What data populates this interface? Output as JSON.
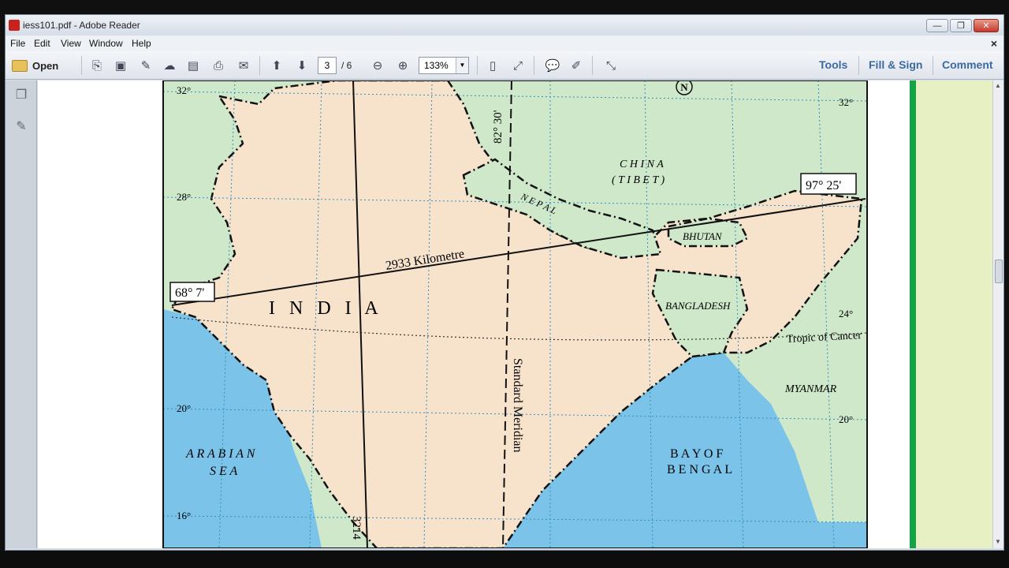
{
  "window": {
    "title": "iess101.pdf - Adobe Reader",
    "min": "—",
    "max": "❐",
    "close": "✕"
  },
  "menu": {
    "file": "File",
    "edit": "Edit",
    "view": "View",
    "window": "Window",
    "help": "Help",
    "close_doc": "×"
  },
  "toolbar": {
    "open_label": "Open",
    "page_current": "3",
    "page_total": "/ 6",
    "zoom": "133%",
    "tools_label": "Tools",
    "fill_sign_label": "Fill & Sign",
    "comment_label": "Comment"
  },
  "map": {
    "labels": {
      "country_main": "I  N  D  I  A",
      "china": "C H I N A",
      "tibet": "( T I B E T )",
      "nepal": "N E P A L",
      "bhutan": "BHUTAN",
      "bangladesh": "BANGLADESH",
      "myanmar": "MYANMAR",
      "arabian_sea_1": "A R A B I A N",
      "arabian_sea_2": "S E A",
      "bay_1": "B A Y   O F",
      "bay_2": "B E N G A L",
      "tropic": "Tropic of Cancer",
      "meridian": "Standard Meridian",
      "meridian_long": "82° 30'",
      "ew_distance": "2933 Kilometre",
      "ns_distance": "3214",
      "west_long": "68° 7'",
      "east_long": "97° 25'",
      "north": "N"
    },
    "lat_ticks_left": [
      "32°",
      "28°",
      "20°",
      "16°"
    ],
    "lat_ticks_right": [
      "32°",
      "24°",
      "20°"
    ],
    "colors": {
      "land": "#f7e3cc",
      "neighbor": "#cfe8c9",
      "sea": "#7cc3ea",
      "border": "#111111",
      "sidebar_green": "#16a347",
      "sidebar_panel": "#e6f0c3"
    }
  }
}
